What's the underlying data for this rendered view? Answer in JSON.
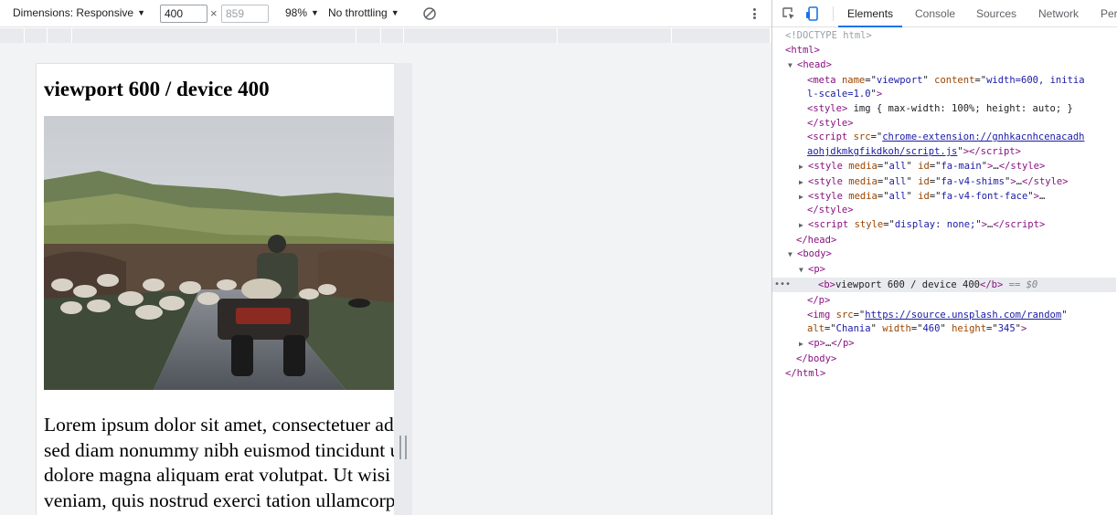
{
  "device_toolbar": {
    "dimensions_label": "Dimensions: Responsive",
    "width_value": "400",
    "height_value": "859",
    "times": "×",
    "zoom_label": "98%",
    "throttling_label": "No throttling",
    "caret": "▼"
  },
  "viewport": {
    "title": "viewport 600 / device 400",
    "image_alt": "Chania",
    "paragraph_lines": [
      "Lorem ipsum dolor sit amet, consectetuer adipiscing",
      "sed diam nonummy nibh euismod tincidunt ut laoreet",
      "dolore magna aliquam erat volutpat. Ut wisi enim ad",
      "veniam, quis nostrud exerci tation ullamcorper"
    ]
  },
  "devtools": {
    "tabs": [
      "Elements",
      "Console",
      "Sources",
      "Network",
      "Performance"
    ],
    "active_tab": "Elements",
    "icons": [
      "inspect-element-icon",
      "device-toggle-icon"
    ],
    "dom": {
      "doctype": "<!DOCTYPE html>",
      "html_open": "html",
      "head_open": "head",
      "meta_tag": "meta",
      "meta_name_attr": "name",
      "meta_name_val": "viewport",
      "meta_content_attr": "content",
      "meta_content_val_1": "width=600, initia",
      "meta_content_val_2": "l-scale=1.0",
      "style_open": "style",
      "style_text": "img { max-width: 100%; height: auto; }",
      "style_close": "/style",
      "script_tag": "script",
      "script_src_attr": "src",
      "script_src_1": "chrome-extension://gnhkacnhcenacadh",
      "script_src_2": "aohjdkmkgfikdkoh/script.js",
      "style_all_1_id": "fa-main",
      "style_all_2_id": "fa-v4-shims",
      "style_all_3_id": "fa-v4-font-face",
      "media_attr": "media",
      "media_val": "all",
      "id_attr": "id",
      "script_style_attr": "style",
      "script_style_val": "display: none;",
      "head_close": "/head",
      "body_open": "body",
      "p_tag": "p",
      "b_text": "viewport 600 / device 400",
      "eq0": "== $0",
      "p_close": "/p",
      "img_tag": "img",
      "img_src": "https://source.unsplash.com/random",
      "img_alt_attr": "alt",
      "img_alt_val": "Chania",
      "img_width_attr": "width",
      "img_width_val": "460",
      "img_height_attr": "height",
      "img_height_val": "345",
      "body_close": "/body",
      "html_close": "/html",
      "ellipsis": "…",
      "dots": "•••"
    }
  },
  "colors": {
    "accent": "#1a73e8",
    "tag": "#881280",
    "attr_name": "#994500",
    "attr_value": "#1a1aa6"
  }
}
